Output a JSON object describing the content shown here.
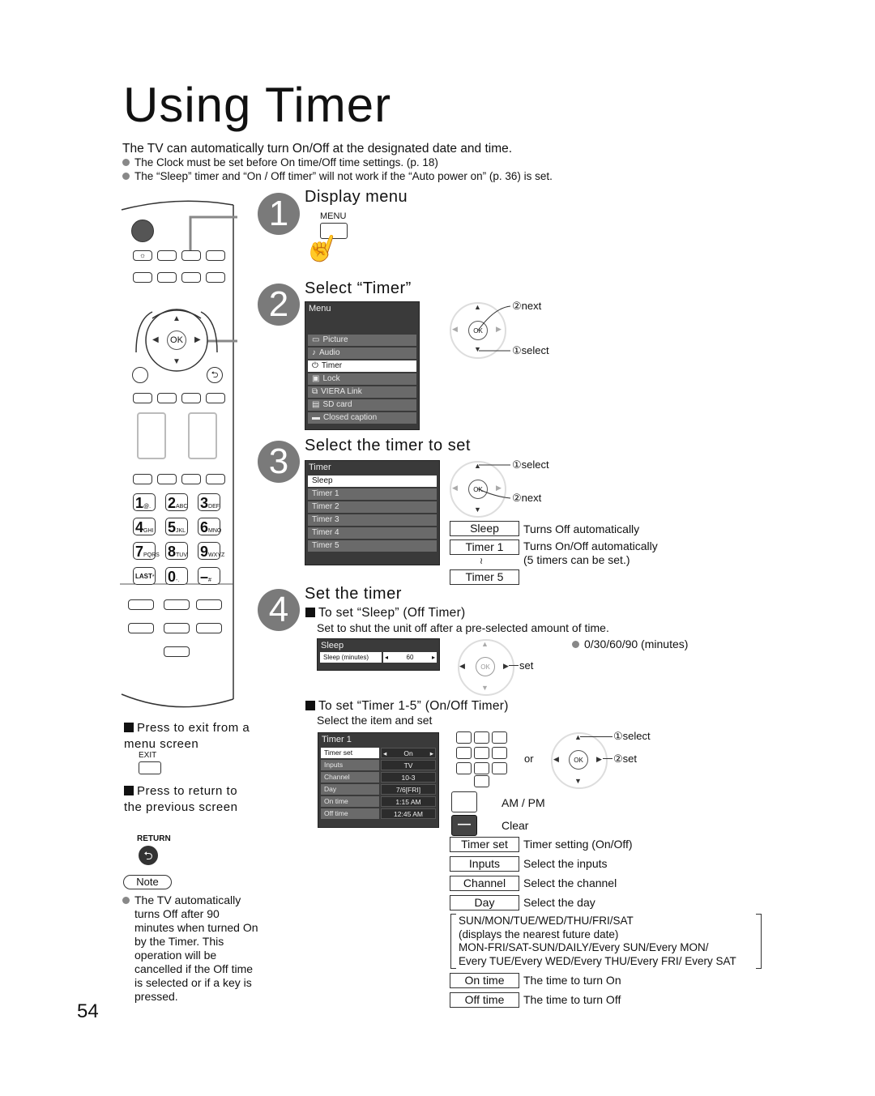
{
  "page": {
    "title": "Using Timer",
    "page_number": "54",
    "intro": "The TV can automatically turn On/Off at the designated date and time.",
    "bullets": [
      "The Clock must be set before On time/Off time settings. (p. 18)",
      "The “Sleep” timer and “On / Off timer” will not work if the “Auto power on” (p. 36) is set."
    ]
  },
  "remote": {
    "keypad": [
      {
        "digit": "1",
        "letters": "@."
      },
      {
        "digit": "2",
        "letters": "ABC"
      },
      {
        "digit": "3",
        "letters": "DEF"
      },
      {
        "digit": "4",
        "letters": "GHI"
      },
      {
        "digit": "5",
        "letters": "JKL"
      },
      {
        "digit": "6",
        "letters": "MNO"
      },
      {
        "digit": "7",
        "letters": "PQRS"
      },
      {
        "digit": "8",
        "letters": "TUV"
      },
      {
        "digit": "9",
        "letters": "WXYZ"
      },
      {
        "digit": "LAST",
        "letters": "*"
      },
      {
        "digit": "0",
        "letters": "-."
      },
      {
        "digit": "–",
        "letters": "#"
      }
    ],
    "ok_label": "OK"
  },
  "side_notes": {
    "exit_text": "Press to exit from a menu screen",
    "exit_key_label": "EXIT",
    "return_text": "Press to return to the previous screen",
    "return_key_label": "RETURN",
    "note_label": "Note",
    "note_text": "The TV automatically turns Off after 90 minutes when turned On by the Timer. This operation will be cancelled if the Off time is selected or if a key is pressed."
  },
  "steps": [
    {
      "number": "1",
      "heading": "Display menu",
      "key_label": "MENU"
    },
    {
      "number": "2",
      "heading": "Select “Timer”",
      "menu_title": "Menu",
      "menu_items": [
        {
          "icon": "picture-icon",
          "glyph": "▭",
          "label": "Picture",
          "selected": false
        },
        {
          "icon": "audio-icon",
          "glyph": "♪",
          "label": "Audio",
          "selected": false
        },
        {
          "icon": "timer-icon",
          "glyph": "⏻",
          "label": "Timer",
          "selected": true
        },
        {
          "icon": "lock-icon",
          "glyph": "▣",
          "label": "Lock",
          "selected": false
        },
        {
          "icon": "viera-link-icon",
          "glyph": "⧉",
          "label": "VIERA Link",
          "selected": false
        },
        {
          "icon": "sd-card-icon",
          "glyph": "▤",
          "label": "SD card",
          "selected": false
        },
        {
          "icon": "closed-caption-icon",
          "glyph": "▬",
          "label": "Closed caption",
          "selected": false
        }
      ],
      "nav_next": "②next",
      "nav_select": "①select"
    },
    {
      "number": "3",
      "heading": "Select the timer to set",
      "menu_title": "Timer",
      "menu_items": [
        "Sleep",
        "Timer 1",
        "Timer 2",
        "Timer 3",
        "Timer 4",
        "Timer 5"
      ],
      "nav_select": "①select",
      "nav_next": "②next",
      "legend": [
        {
          "key": "Sleep",
          "desc": "Turns Off automatically"
        },
        {
          "key": "Timer 1",
          "desc": "Turns On/Off automatically"
        },
        {
          "key": "≀",
          "desc": "(5 timers can be set.)"
        },
        {
          "key": "Timer 5",
          "desc": ""
        }
      ]
    },
    {
      "number": "4",
      "heading": "Set the timer",
      "sleep": {
        "subheading": "To set “Sleep” (Off Timer)",
        "description": "Set to shut the unit off after a pre-selected amount of time.",
        "osd_title": "Sleep",
        "field_label": "Sleep (minutes)",
        "field_value": "60",
        "options_note": "0/30/60/90 (minutes)",
        "nav_set": "set"
      },
      "timer": {
        "subheading": "To set “Timer 1-5” (On/Off Timer)",
        "description": "Select the item and set",
        "osd_title": "Timer 1",
        "rows": [
          {
            "label": "Timer set",
            "value": "On",
            "selected": true
          },
          {
            "label": "Inputs",
            "value": "TV",
            "selected": false
          },
          {
            "label": "Channel",
            "value": "10-3",
            "selected": false
          },
          {
            "label": "Day",
            "value": "7/6[FRI]",
            "selected": false
          },
          {
            "label": "On time",
            "value": "1:15 AM",
            "selected": false
          },
          {
            "label": "Off time",
            "value": "12:45 AM",
            "selected": false
          }
        ],
        "or_label": "or",
        "nav_select": "①select",
        "nav_set": "②set",
        "ampm_label": "AM / PM",
        "clear_label": "Clear",
        "legend": [
          {
            "key": "Timer set",
            "desc": "Timer setting (On/Off)"
          },
          {
            "key": "Inputs",
            "desc": "Select the inputs"
          },
          {
            "key": "Channel",
            "desc": "Select the channel"
          },
          {
            "key": "Day",
            "desc": "Select the day"
          }
        ],
        "day_options": [
          "SUN/MON/TUE/WED/THU/FRI/SAT",
          "(displays the nearest future date)",
          "MON-FRI/SAT-SUN/DAILY/Every SUN/Every MON/",
          "Every TUE/Every WED/Every THU/Every FRI/ Every SAT"
        ],
        "legend2": [
          {
            "key": "On time",
            "desc": "The time to turn On"
          },
          {
            "key": "Off time",
            "desc": "The time to turn Off"
          }
        ]
      }
    }
  ]
}
